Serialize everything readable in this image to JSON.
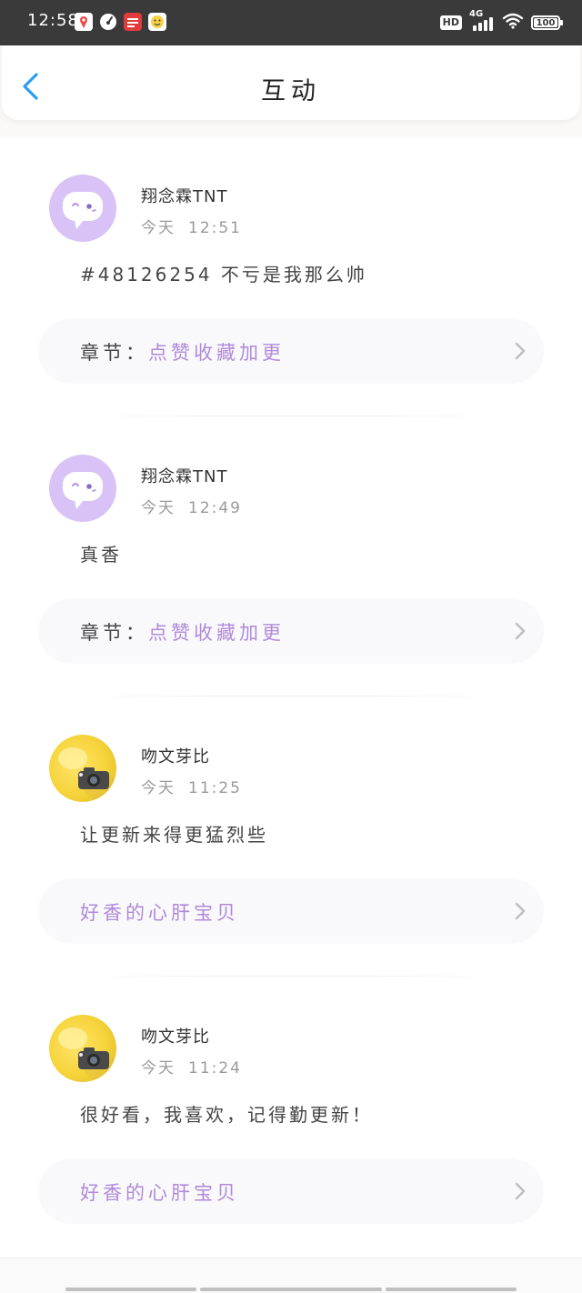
{
  "status_bar": {
    "time": "12:58",
    "apps": [
      {
        "icon": "map-pin-app-icon",
        "color": "#e84c4c"
      },
      {
        "icon": "speedometer-app-icon",
        "color": "#ffffff"
      },
      {
        "icon": "news-app-icon",
        "color": "#e23b3b"
      },
      {
        "icon": "emoji-app-icon",
        "color": "#f5d24a"
      }
    ],
    "hd": "HD",
    "network": "4G",
    "battery": "100"
  },
  "header": {
    "title": "互动"
  },
  "items": [
    {
      "name": "翔念霖TNT",
      "day": "今天",
      "time": "12:51",
      "content": "#48126254 不亏是我那么帅",
      "chapter_prefix": "章节：",
      "chapter_name": "点赞收藏加更",
      "avatar": "default-chat-avatar"
    },
    {
      "name": "翔念霖TNT",
      "day": "今天",
      "time": "12:49",
      "content": "真香",
      "chapter_prefix": "章节：",
      "chapter_name": "点赞收藏加更",
      "avatar": "default-chat-avatar"
    },
    {
      "name": "吻文芽比",
      "day": "今天",
      "time": "11:25",
      "content": "让更新来得更猛烈些",
      "chapter_prefix": "",
      "chapter_name": "好香的心肝宝贝",
      "avatar": "photo-avatar"
    },
    {
      "name": "吻文芽比",
      "day": "今天",
      "time": "11:24",
      "content": "很好看，我喜欢，记得勤更新！",
      "chapter_prefix": "",
      "chapter_name": "好香的心肝宝贝",
      "avatar": "photo-avatar"
    }
  ],
  "colors": {
    "accent_blue": "#2a9df4",
    "chapter_purple": "#b08ad9",
    "avatar_purple": "#d8c2f6"
  }
}
